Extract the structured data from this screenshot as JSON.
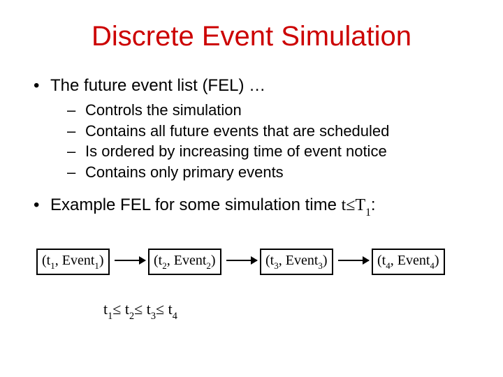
{
  "title": "Discrete Event Simulation",
  "main_bullet": "The future event list (FEL) …",
  "sub_items": [
    "Controls the simulation",
    "Contains all future events that are scheduled",
    "Is ordered by increasing time of event notice",
    "Contains only primary events"
  ],
  "example_prefix": "Example FEL for some simulation time ",
  "example_math_t": "t",
  "example_math_le": "≤",
  "example_math_T": "T",
  "example_math_sub": "1",
  "example_math_colon": ":",
  "nodes": [
    {
      "t": "t",
      "ti": "1",
      "e": "Event",
      "ei": "1"
    },
    {
      "t": "t",
      "ti": "2",
      "e": "Event",
      "ei": "2"
    },
    {
      "t": "t",
      "ti": "3",
      "e": "Event",
      "ei": "3"
    },
    {
      "t": "t",
      "ti": "4",
      "e": "Event",
      "ei": "4"
    }
  ],
  "ordering": {
    "t": "t",
    "i1": "1",
    "le1": "≤ ",
    "i2": "2",
    "le2": "≤ ",
    "i3": "3",
    "le3": "≤ ",
    "i4": "4"
  }
}
